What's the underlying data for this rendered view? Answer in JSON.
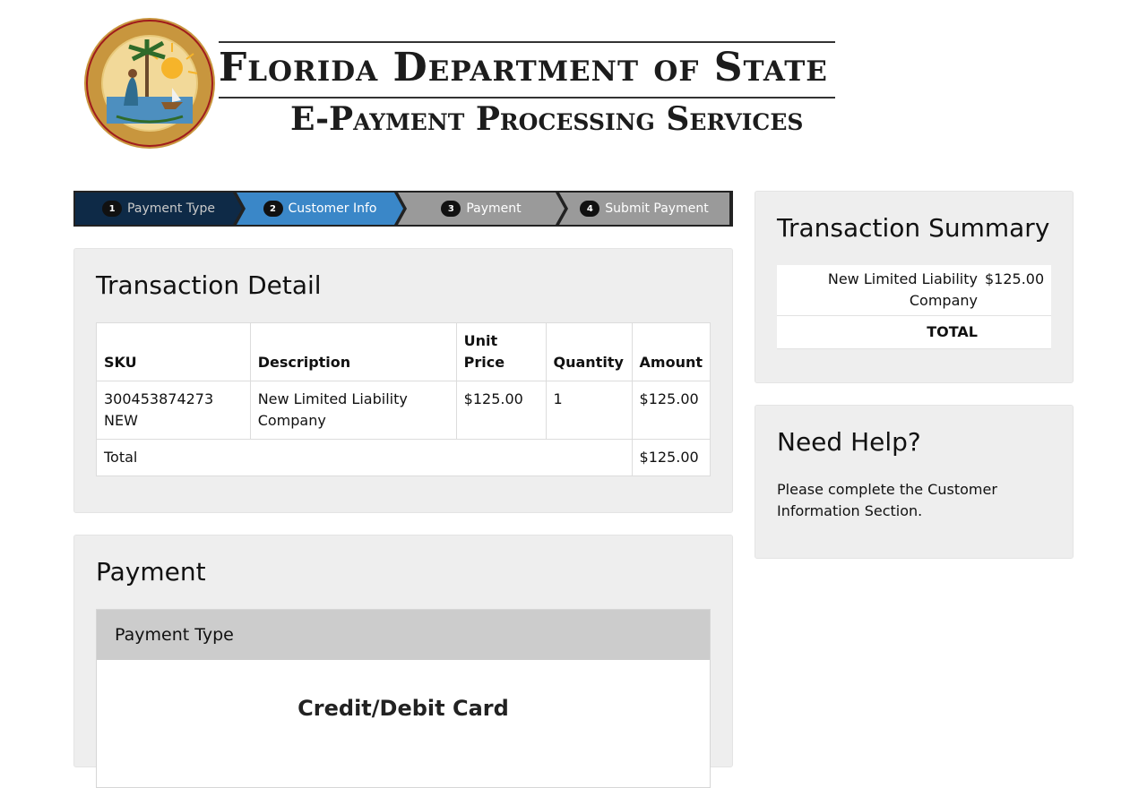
{
  "header": {
    "agency": "Florida Department of State",
    "service": "E-Payment Processing Services",
    "seal_text": "GREAT SEAL OF THE STATE OF FLORIDA · IN GOD WE TRUST"
  },
  "steps": [
    {
      "num": "1",
      "label": "Payment Type",
      "state": "done"
    },
    {
      "num": "2",
      "label": "Customer Info",
      "state": "active"
    },
    {
      "num": "3",
      "label": "Payment",
      "state": "todo"
    },
    {
      "num": "4",
      "label": "Submit Payment",
      "state": "todo"
    }
  ],
  "detail": {
    "title": "Transaction Detail",
    "columns": [
      "SKU",
      "Description",
      "Unit Price",
      "Quantity",
      "Amount"
    ],
    "rows": [
      {
        "sku": "300453874273 NEW",
        "description": "New Limited Liability Company",
        "unit_price": "$125.00",
        "quantity": "1",
        "amount": "$125.00"
      }
    ],
    "total_label": "Total",
    "total_value": "$125.00"
  },
  "payment": {
    "title": "Payment",
    "type_header": "Payment Type",
    "option": "Credit/Debit Card"
  },
  "summary": {
    "title": "Transaction Summary",
    "item_label": "New Limited Liability Company",
    "item_value": "$125.00",
    "total_label": "TOTAL",
    "total_value": ""
  },
  "help": {
    "title": "Need Help?",
    "text": "Please complete the Customer Information Section."
  },
  "colors": {
    "step_done": "#0e2a47",
    "step_active": "#3a87c8",
    "step_todo": "#9a9a9a",
    "panel_bg": "#eeeeee"
  }
}
